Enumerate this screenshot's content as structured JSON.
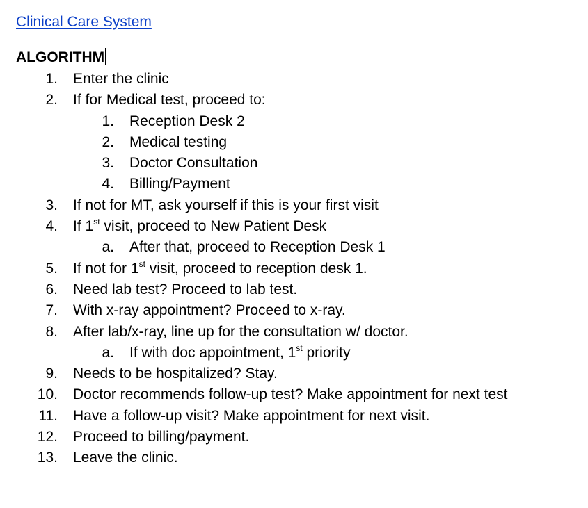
{
  "document": {
    "title_link": "Clinical Care System",
    "heading": "ALGORITHM"
  },
  "steps": [
    {
      "marker": "1.",
      "text": "Enter the clinic",
      "level": 1
    },
    {
      "marker": "2.",
      "text": "If for Medical test, proceed to:",
      "level": 1
    },
    {
      "marker": "1.",
      "text": "Reception Desk 2",
      "level": 2
    },
    {
      "marker": "2.",
      "text": "Medical testing",
      "level": 2
    },
    {
      "marker": "3.",
      "text": "Doctor Consultation",
      "level": 2
    },
    {
      "marker": "4.",
      "text": "Billing/Payment",
      "level": 2
    },
    {
      "marker": "3.",
      "text": "If not for MT, ask yourself if this is your first visit",
      "level": 1
    },
    {
      "marker": "4.",
      "text_before": "If 1",
      "sup": "st",
      "text_after": " visit, proceed to New Patient Desk",
      "level": 1
    },
    {
      "marker": "a.",
      "text": "After that, proceed to Reception Desk 1",
      "level": 2
    },
    {
      "marker": "5.",
      "text_before": "If not for 1",
      "sup": "st",
      "text_after": " visit, proceed to reception desk 1.",
      "level": 1
    },
    {
      "marker": "6.",
      "text": "Need lab test? Proceed to lab test.",
      "level": 1
    },
    {
      "marker": "7.",
      "text": "With x-ray appointment? Proceed to x-ray.",
      "level": 1
    },
    {
      "marker": "8.",
      "text": "After lab/x-ray, line up for the consultation w/ doctor.",
      "level": 1
    },
    {
      "marker": "a.",
      "text_before": "If with doc appointment, 1",
      "sup": "st",
      "text_after": " priority",
      "level": 2
    },
    {
      "marker": "9.",
      "text": "Needs to be hospitalized? Stay.",
      "level": 1
    },
    {
      "marker": "10.",
      "text": "Doctor recommends follow-up test? Make appointment for next test",
      "level": 1
    },
    {
      "marker": "11.",
      "text": "Have a follow-up visit? Make appointment for next visit.",
      "level": 1
    },
    {
      "marker": "12.",
      "text": "Proceed to billing/payment.",
      "level": 1
    },
    {
      "marker": "13.",
      "text": "Leave the clinic.",
      "level": 1
    }
  ],
  "colors": {
    "link": "#0b3fc8",
    "text": "#000000",
    "background": "#ffffff"
  }
}
